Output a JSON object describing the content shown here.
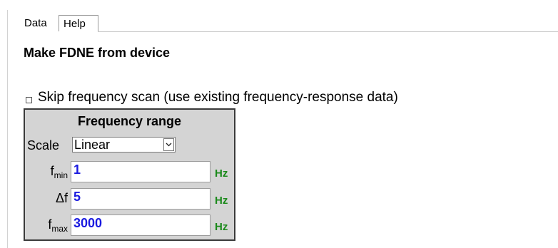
{
  "tabs": [
    {
      "label": "Data",
      "active": true
    },
    {
      "label": "Help",
      "active": false
    }
  ],
  "page_title": "Make FDNE from device",
  "skip_scan": {
    "label": "Skip frequency scan (use existing frequency-response data)",
    "checked": false
  },
  "frequency_range": {
    "title": "Frequency range",
    "scale": {
      "label": "Scale",
      "selected": "Linear"
    },
    "fmin": {
      "label_main": "f",
      "label_sub": "min",
      "value": "1",
      "unit": "Hz"
    },
    "delta_f": {
      "label": "Δf",
      "value": "5",
      "unit": "Hz"
    },
    "fmax": {
      "label_main": "f",
      "label_sub": "max",
      "value": "3000",
      "unit": "Hz"
    }
  },
  "colors": {
    "input_text": "#1a1ae0",
    "unit_text": "#1b8a1b",
    "panel_bg": "#d4d4d4"
  }
}
